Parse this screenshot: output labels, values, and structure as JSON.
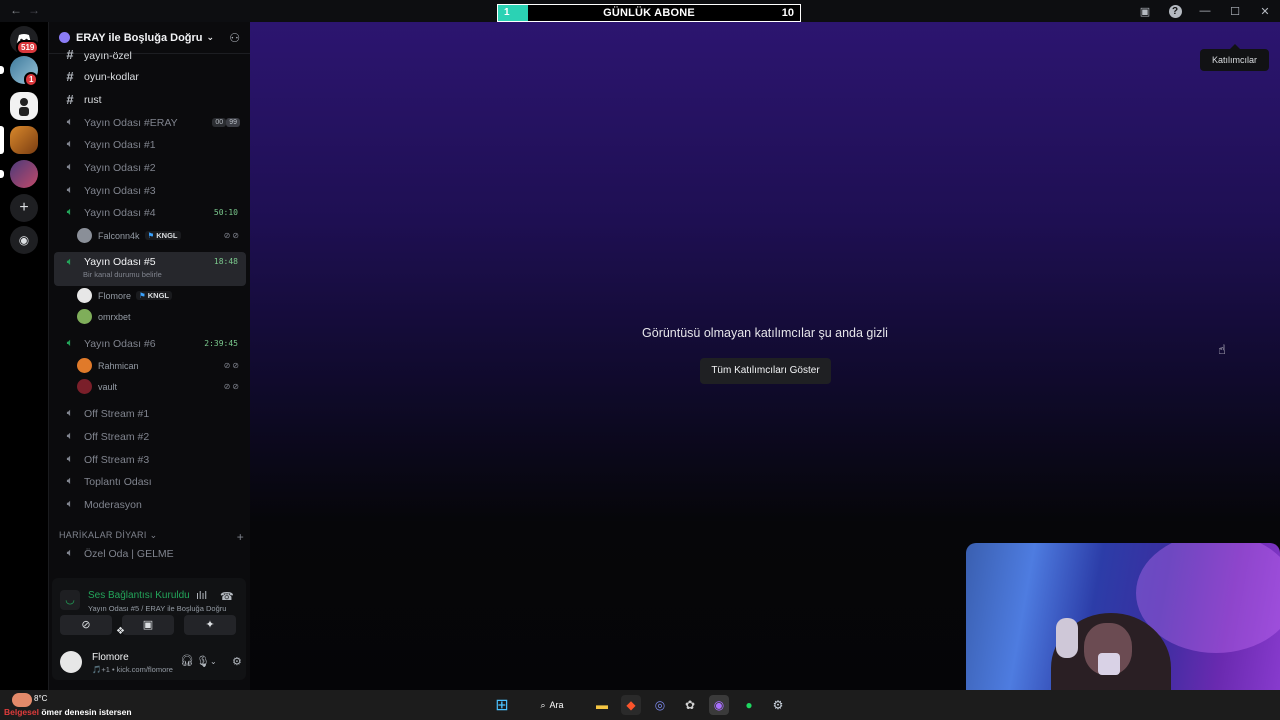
{
  "topbar": {
    "back": "←",
    "forward": "→",
    "sub_goal": {
      "current": "1",
      "title": "GÜNLÜK ABONE",
      "goal": "10",
      "progress": 0.1,
      "fill_color": "#2bd2b4"
    },
    "icons": [
      "inbox-icon",
      "help-icon",
      "minimize-icon",
      "maximize-icon",
      "close-icon"
    ]
  },
  "rail": {
    "home_badge": "519",
    "server_badge": "1"
  },
  "server": {
    "name": "ERAY ile Boşluğa Doğru",
    "chevron": "⌄"
  },
  "channels": {
    "text": [
      {
        "name": "yayın-özel"
      },
      {
        "name": "oyun-kodlar"
      },
      {
        "name": "rust"
      }
    ],
    "voice_eray": {
      "name": "Yayın Odası #ERAY",
      "caps_a": "00",
      "caps_b": "99"
    },
    "voice_1": {
      "name": "Yayın Odası #1"
    },
    "voice_2": {
      "name": "Yayın Odası #2"
    },
    "voice_3": {
      "name": "Yayın Odası #3"
    },
    "voice_4": {
      "name": "Yayın Odası #4",
      "time": "50:10",
      "member": "Falconn4k",
      "tag": "KNGL"
    },
    "voice_5": {
      "name": "Yayın Odası #5",
      "time": "18:48",
      "status": "Bir kanal durumu belirle",
      "member1": "Flomore",
      "tag1": "KNGL",
      "member2": "omrxbet"
    },
    "voice_6": {
      "name": "Yayın Odası #6",
      "time": "2:39:45",
      "member1": "Rahmican",
      "member2": "vault"
    },
    "off_1": {
      "name": "Off Stream #1"
    },
    "off_2": {
      "name": "Off Stream #2"
    },
    "off_3": {
      "name": "Off Stream #3"
    },
    "meeting": {
      "name": "Toplantı Odası"
    },
    "mod": {
      "name": "Moderasyon"
    },
    "category": {
      "name": "HARİKALAR DİYARI"
    },
    "private": {
      "name": "Özel Oda | GELME"
    }
  },
  "voice_panel": {
    "title": "Ses Bağlantısı Kuruldu",
    "subtitle": "Yayın Odası #5 / ERAY ile Boşluğa Doğru"
  },
  "user": {
    "name": "Flomore",
    "status": "🎵+1 • kick.com/flomore"
  },
  "main": {
    "tooltip": "Katılımcılar",
    "hidden_message": "Görüntüsü olmayan katılımcılar şu anda gizli",
    "show_all_button": "Tüm Katılımcıları Göster",
    "gradient_top": "#2c1570"
  },
  "taskbar": {
    "temperature": "8°C",
    "ticker_a": "Belgesel",
    "ticker_b": "ömer denesin istersen",
    "search_label": "Ara"
  },
  "colors": {
    "voice_connected": "#23a55a",
    "badge": "#da373c"
  }
}
